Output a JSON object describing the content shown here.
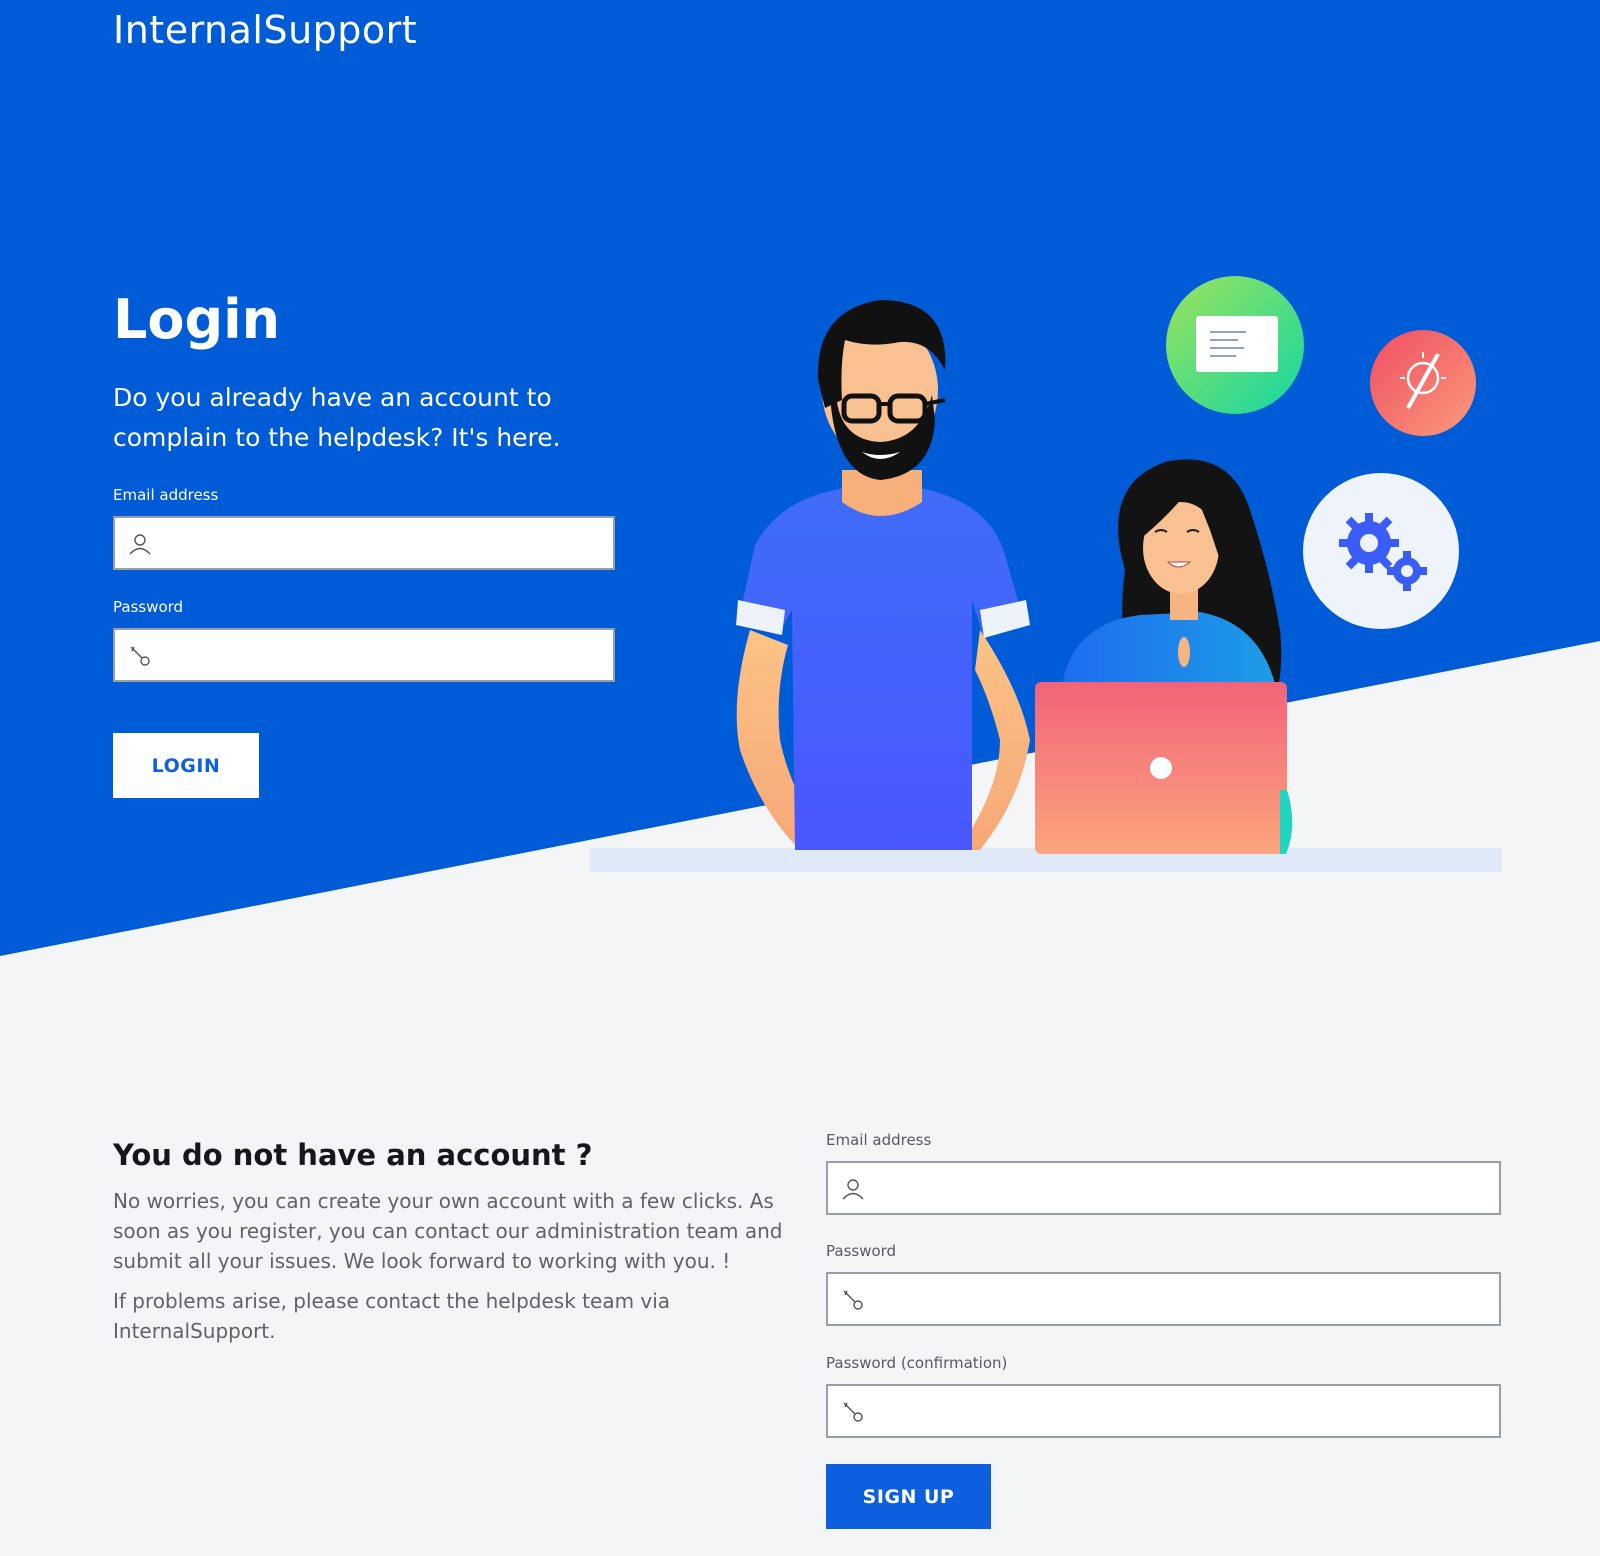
{
  "brand": {
    "name": "InternalSupport"
  },
  "login": {
    "title": "Login",
    "subtitle": "Do you already have an account to complain to the helpdesk? It's here.",
    "email_label": "Email address",
    "email_value": "",
    "password_label": "Password",
    "password_value": "",
    "button_label": "LOGIN"
  },
  "register": {
    "title": "You do not have an account ?",
    "paragraph1": "No worries, you can create your own account with a few clicks. As soon as you register, you can contact our administration team and submit all your issues. We look forward to working with you. !",
    "paragraph2": "If problems arise, please contact the helpdesk team via InternalSupport.",
    "email_label": "Email address",
    "email_value": "",
    "password_label": "Password",
    "password_value": "",
    "confirm_label": "Password (confirmation)",
    "confirm_value": "",
    "button_label": "SIGN UP"
  },
  "icons": {
    "email_field": "user-icon",
    "password_field": "key-icon",
    "bubbles": [
      "document-icon",
      "paintbrush-idea-icon",
      "gears-icon"
    ]
  },
  "colors": {
    "hero_blue": "#005bd6",
    "page_background": "#f4f5f7",
    "accent_button": "#0d5fe0",
    "laptop": "#f5737f",
    "shirt": "#4c62ff"
  }
}
